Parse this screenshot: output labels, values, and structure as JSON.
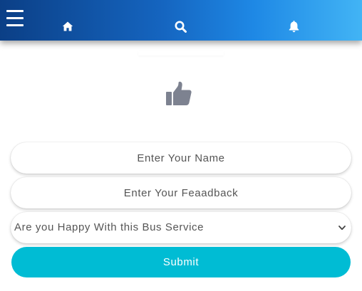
{
  "header": {
    "menu_icon": "hamburger-icon",
    "nav_icons": [
      "home-icon",
      "search-icon",
      "bell-icon"
    ],
    "gradient_colors": [
      "#0b3f86",
      "#1565c0",
      "#42b4f5"
    ]
  },
  "hero": {
    "icon": "thumbs-up-icon",
    "icon_color": "#7d8290"
  },
  "form": {
    "name_placeholder": "Enter Your Name",
    "feedback_placeholder": "Enter Your Feaadback",
    "happy_select": {
      "selected": "Are you Happy With this Bus Service"
    },
    "submit_label": "Submit",
    "submit_color": "#00bcd4"
  }
}
